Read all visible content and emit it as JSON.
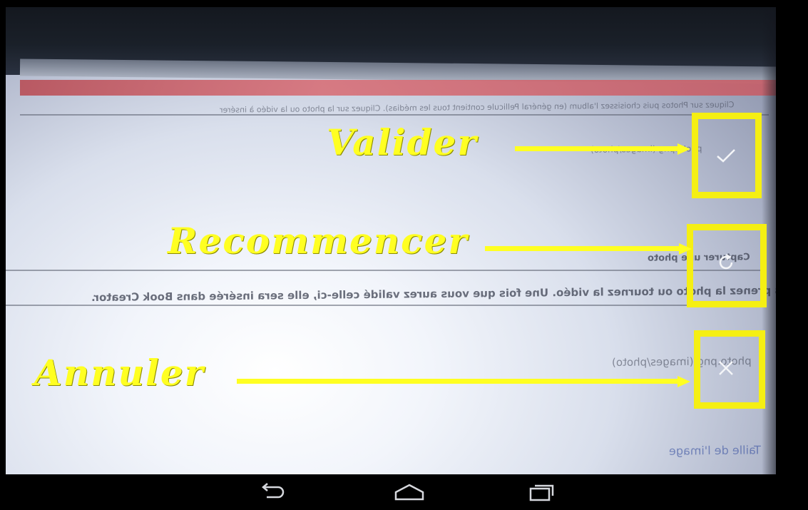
{
  "camera_preview": {
    "mirrored_texts": [
      "Cliquez sur Photos puis choisissez l'album (en général Pellicule contient tous les médias). Cliquez sur la photo ou la vidéo à insérer",
      "photo.png (images/photo)",
      "Capturer une photo",
      "Prenez votre photo puis prenez la photo ou tournez la vidéo. Une fois que vous aurez validé celle-ci, elle sera insérée dans Book Creator.",
      "photo.png (images/photo)",
      "Taille de l'image"
    ]
  },
  "annotations": {
    "valider": "Valider",
    "recommencer": "Recommencer",
    "annuler": "Annuler"
  },
  "controls": {
    "accept_icon": "check-icon",
    "retake_icon": "refresh-icon",
    "cancel_icon": "close-icon"
  },
  "navbar": {
    "back_icon": "back-icon",
    "home_icon": "home-icon",
    "recents_icon": "recents-icon"
  },
  "colors": {
    "highlight": "#f5ef13",
    "annotation_text": "#ffff22"
  }
}
